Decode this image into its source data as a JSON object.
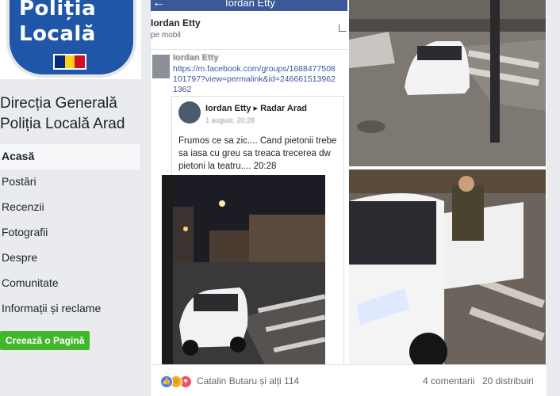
{
  "logo": {
    "line1": "Poliția",
    "line2": "Locală",
    "flag_colors": [
      "#002b7f",
      "#fcd116",
      "#ce1126"
    ]
  },
  "page": {
    "name": "Direcția Generală Poliția Locală Arad"
  },
  "nav": {
    "items": [
      {
        "label": "Acasă",
        "active": true
      },
      {
        "label": "Postări"
      },
      {
        "label": "Recenzii"
      },
      {
        "label": "Fotografii"
      },
      {
        "label": "Despre"
      },
      {
        "label": "Comunitate"
      },
      {
        "label": "Informații și reclame"
      }
    ],
    "create_page": "Creează o Pagină"
  },
  "screenshot": {
    "topbar_name": "Iordan Etty",
    "author": "Iordan Etty",
    "subtitle": "pe mobil",
    "shared_name": "Iordan Etty",
    "link": "https://m.facebook.com/groups/1688477508101797?view=permalink&id=2466615139621362",
    "inner": {
      "author": "Iordan Etty",
      "arrow": "▸",
      "group": "Radar Arad",
      "meta": "1 august, 20:28",
      "text": "Frumos ce sa zic.... Cand pietonii trebe sa iasa cu greu sa treaca trecerea dw pietoni la teatru.... 20:28"
    }
  },
  "footer": {
    "reactors": "Catalin Butaru și alți 114",
    "comments": "4 comentarii",
    "shares": "20 distribuiri"
  },
  "colors": {
    "fb_blue": "#3b5998",
    "green": "#42b72a",
    "like": "#4080ff",
    "love": "#f25268",
    "haha": "#f7b125"
  }
}
